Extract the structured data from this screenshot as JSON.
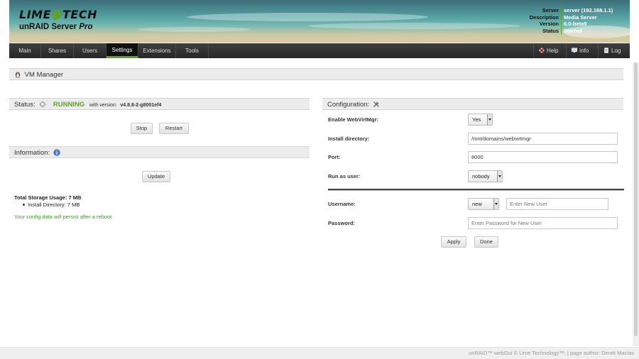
{
  "header": {
    "brand_left": "LIME",
    "brand_right": "TECH",
    "product": "unRAID Server",
    "edition": "Pro",
    "server_info": [
      {
        "key": "Server",
        "value": "server (192.168.1.1)"
      },
      {
        "key": "Description",
        "value": "Media Server"
      },
      {
        "key": "Version",
        "value": "6.0-beta9"
      },
      {
        "key": "Status",
        "value": "Started"
      }
    ],
    "colors": {
      "accent": "#5ea327",
      "nav_bg": "#2f2f2f"
    }
  },
  "nav": {
    "tabs": [
      {
        "label": "Main"
      },
      {
        "label": "Shares"
      },
      {
        "label": "Users"
      },
      {
        "label": "Settings",
        "active": true
      },
      {
        "label": "Extensions"
      },
      {
        "label": "Tools"
      }
    ],
    "right": [
      {
        "label": "Help",
        "icon": "lifebuoy-icon"
      },
      {
        "label": "Info",
        "icon": "monitor-icon"
      },
      {
        "label": "Log",
        "icon": "document-icon"
      }
    ]
  },
  "page": {
    "title": "VM Manager",
    "title_icon": "tux-icon"
  },
  "status": {
    "heading": "Status:",
    "state": "RUNNING",
    "version_prefix": "with version:",
    "version": "v4.8.8-2-g8001ef4",
    "state_color": "#5ea327",
    "stop_label": "Stop",
    "restart_label": "Restart"
  },
  "information": {
    "heading": "Information:",
    "update_label": "Update",
    "total_storage": "Total Storage Usage: 7 MB",
    "install_dir_usage": "Install Directory: 7 MB",
    "persist_note": "Your config data will persist after a reboot"
  },
  "configuration": {
    "heading": "Configuration:",
    "enable_label": "Enable WebVirtMgr:",
    "enable_value": "Yes",
    "install_dir_label": "Install directory:",
    "install_dir_value": "/mnt/domains/webvirtmgr",
    "port_label": "Port:",
    "port_value": "8000",
    "run_as_label": "Run as user:",
    "run_as_value": "nobody",
    "username_label": "Username:",
    "username_select": "new",
    "username_placeholder": "Enter New User",
    "password_label": "Password:",
    "password_placeholder": "Enter Password for New User",
    "apply_label": "Apply",
    "done_label": "Done"
  },
  "footer": {
    "text": "unRAID™ webGui © Lime Technology™; | page author: Derek Macias"
  }
}
